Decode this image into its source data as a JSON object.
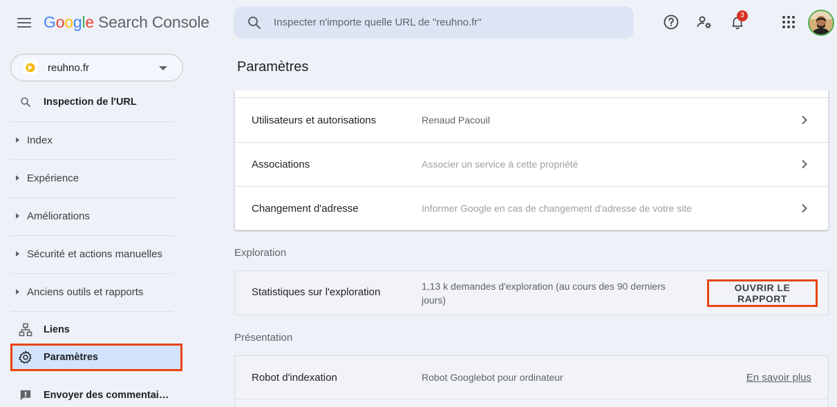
{
  "header": {
    "logo_letters": [
      "G",
      "o",
      "o",
      "g",
      "l",
      "e"
    ],
    "product": "Search Console",
    "search_placeholder": "Inspecter n'importe quelle URL de \"reuhno.fr\"",
    "notifications_count": "3"
  },
  "sidebar": {
    "property": "reuhno.fr",
    "url_inspection": "Inspection de l'URL",
    "groups": [
      "Index",
      "Expérience",
      "Améliorations",
      "Sécurité et actions manuelles",
      "Anciens outils et rapports"
    ],
    "links": "Liens",
    "settings": "Paramètres",
    "feedback": "Envoyer des commentai…"
  },
  "main": {
    "title": "Paramètres",
    "general_rows": [
      {
        "title": "Utilisateurs et autorisations",
        "desc": "Renaud Pacouil"
      },
      {
        "title": "Associations",
        "desc": "Associer un service à cette propriété"
      },
      {
        "title": "Changement d'adresse",
        "desc": "Informer Google en cas de changement d'adresse de votre site"
      }
    ],
    "exploration": {
      "section": "Exploration",
      "title": "Statistiques sur l'exploration",
      "desc_line1": "1,13 k demandes d'exploration (au cours des 90 derniers",
      "desc_line2": "jours)",
      "button": "OUVRIR LE RAPPORT"
    },
    "presentation": {
      "section": "Présentation",
      "title": "Robot d'indexation",
      "desc": "Robot Googlebot pour ordinateur",
      "link": "En savoir plus"
    }
  },
  "colors": {
    "highlight": "#e8440d",
    "active_bg": "#d3e3fd",
    "badge": "#d93025"
  }
}
